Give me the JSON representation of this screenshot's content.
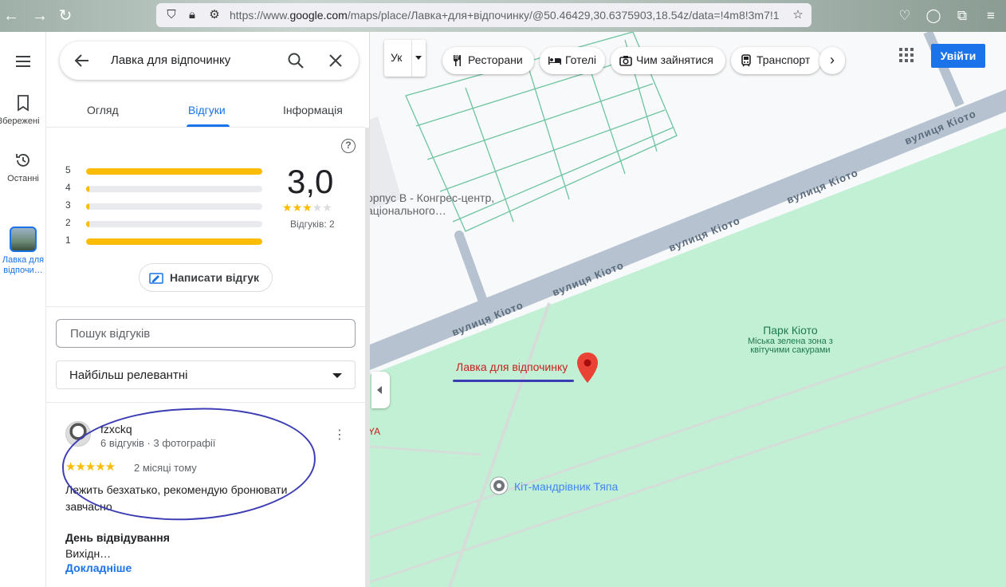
{
  "browser": {
    "url_prefix": "https://www.",
    "url_domain": "google.com",
    "url_rest": "/maps/place/Лавка+для+відпочинку/@50.46429,30.6375903,18.54z/data=!4m8!3m7!1"
  },
  "rail": {
    "saved_label": "Збережені",
    "recent_label": "Останні",
    "place_label": "Лавка для відпочи…"
  },
  "search": {
    "query": "Лавка для відпочинку"
  },
  "tabs": [
    "Огляд",
    "Відгуки",
    "Інформація"
  ],
  "summary": {
    "rating": "3,0",
    "review_count": "Відгуків: 2",
    "stars": 3,
    "distribution": [
      {
        "stars": "5",
        "share": 1.0
      },
      {
        "stars": "4",
        "share": 0.02
      },
      {
        "stars": "3",
        "share": 0.02
      },
      {
        "stars": "2",
        "share": 0.02
      },
      {
        "stars": "1",
        "share": 1.0
      }
    ],
    "write_review": "Написати відгук"
  },
  "review_search": {
    "placeholder": "Пошук відгуків"
  },
  "sort": {
    "selected": "Найбільш релевантні"
  },
  "review": {
    "author": "fzxckq",
    "meta": "6 відгуків · 3 фотографії",
    "stars": "★★★★★",
    "when": "2 місяці тому",
    "text": "Лежить безхатько, рекомендую бронювати завчасно",
    "visit_title": "День відвідування",
    "visit_value": "Вихідн…",
    "more": "Докладніше"
  },
  "map_controls": {
    "layer_label": "Ук",
    "chips": [
      "Ресторани",
      "Готелі",
      "Чим зайнятися",
      "Транспорт"
    ],
    "signin": "Увійти"
  },
  "map_labels": {
    "street": "вулиця Кіото",
    "building_line1": "орпус В - Конгрес-центр,",
    "building_line2": "аціонального…",
    "park_name": "Парк Кіото",
    "park_desc_line1": "Міська зелена зона з",
    "park_desc_line2": "квітучими сакурами",
    "place_name": "Лавка для відпочинку",
    "poi_name": "Кіт-мандрівник Тяпа",
    "cut_label": "YA"
  },
  "colors": {
    "accent": "#1a73e8",
    "star": "#fbbc04",
    "park": "#c2f0d5",
    "road": "#b6c2cf",
    "pin": "#ea4335",
    "annotation": "#3c3cb4"
  }
}
